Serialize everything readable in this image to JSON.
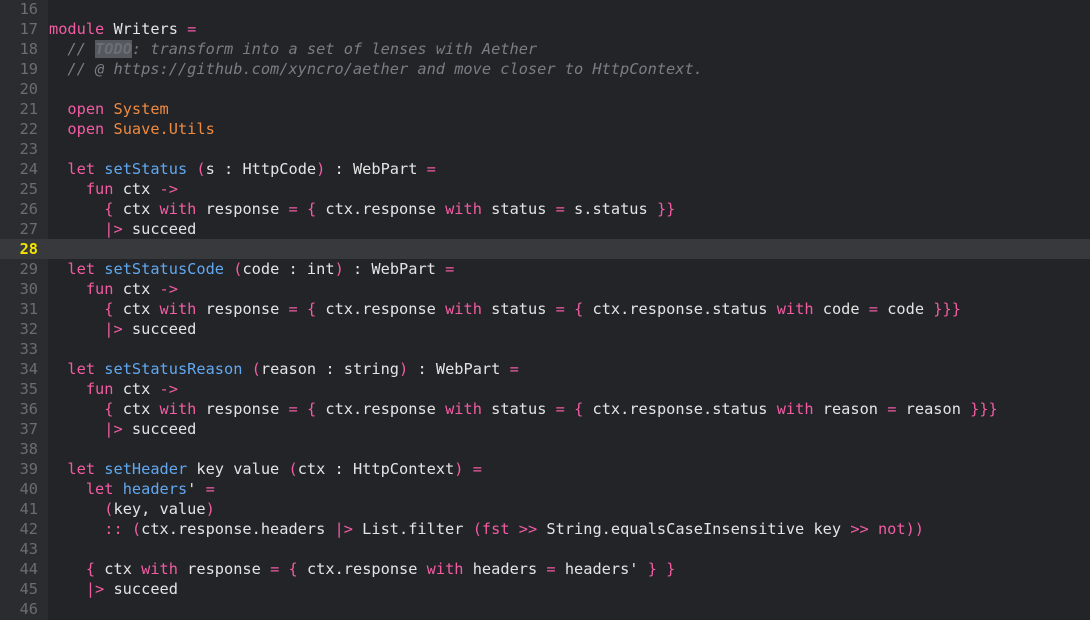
{
  "editor": {
    "current_line": 28,
    "colors": {
      "background": "#222428",
      "gutter": "#2a2c30",
      "current_line": "#37393d",
      "current_line_number": "#f2e300",
      "keyword": "#f25ca3",
      "module": "#f08a3f",
      "function": "#62a8f0",
      "comment": "#7a7d84",
      "text": "#e4e4e4"
    },
    "lines": [
      {
        "n": "16",
        "tokens": []
      },
      {
        "n": "17",
        "tokens": [
          {
            "t": "kw",
            "v": "module"
          },
          {
            "t": "plain",
            "v": " Writers "
          },
          {
            "t": "op",
            "v": "="
          }
        ]
      },
      {
        "n": "18",
        "tokens": [
          {
            "t": "plain",
            "v": "  "
          },
          {
            "t": "cm",
            "v": "// "
          },
          {
            "t": "todo",
            "v": "TODO"
          },
          {
            "t": "cm",
            "v": ": transform into a set of lenses with Aether"
          }
        ]
      },
      {
        "n": "19",
        "tokens": [
          {
            "t": "plain",
            "v": "  "
          },
          {
            "t": "cm",
            "v": "// @ https://github.com/xyncro/aether and move closer to HttpContext."
          }
        ]
      },
      {
        "n": "20",
        "tokens": []
      },
      {
        "n": "21",
        "tokens": [
          {
            "t": "plain",
            "v": "  "
          },
          {
            "t": "kw",
            "v": "open"
          },
          {
            "t": "plain",
            "v": " "
          },
          {
            "t": "mod",
            "v": "System"
          }
        ]
      },
      {
        "n": "22",
        "tokens": [
          {
            "t": "plain",
            "v": "  "
          },
          {
            "t": "kw",
            "v": "open"
          },
          {
            "t": "plain",
            "v": " "
          },
          {
            "t": "mod",
            "v": "Suave.Utils"
          }
        ]
      },
      {
        "n": "23",
        "tokens": []
      },
      {
        "n": "24",
        "tokens": [
          {
            "t": "plain",
            "v": "  "
          },
          {
            "t": "kw",
            "v": "let"
          },
          {
            "t": "plain",
            "v": " "
          },
          {
            "t": "fn",
            "v": "setStatus"
          },
          {
            "t": "plain",
            "v": " "
          },
          {
            "t": "op",
            "v": "("
          },
          {
            "t": "plain",
            "v": "s : HttpCode"
          },
          {
            "t": "op",
            "v": ")"
          },
          {
            "t": "plain",
            "v": " : WebPart "
          },
          {
            "t": "op",
            "v": "="
          }
        ]
      },
      {
        "n": "25",
        "tokens": [
          {
            "t": "plain",
            "v": "    "
          },
          {
            "t": "kw",
            "v": "fun"
          },
          {
            "t": "plain",
            "v": " ctx "
          },
          {
            "t": "op",
            "v": "->"
          }
        ]
      },
      {
        "n": "26",
        "tokens": [
          {
            "t": "plain",
            "v": "      "
          },
          {
            "t": "op",
            "v": "{"
          },
          {
            "t": "plain",
            "v": " ctx "
          },
          {
            "t": "kw",
            "v": "with"
          },
          {
            "t": "plain",
            "v": " response "
          },
          {
            "t": "op",
            "v": "="
          },
          {
            "t": "plain",
            "v": " "
          },
          {
            "t": "op",
            "v": "{"
          },
          {
            "t": "plain",
            "v": " ctx.response "
          },
          {
            "t": "kw",
            "v": "with"
          },
          {
            "t": "plain",
            "v": " status "
          },
          {
            "t": "op",
            "v": "="
          },
          {
            "t": "plain",
            "v": " s.status "
          },
          {
            "t": "op",
            "v": "}}"
          }
        ]
      },
      {
        "n": "27",
        "tokens": [
          {
            "t": "plain",
            "v": "      "
          },
          {
            "t": "op",
            "v": "|>"
          },
          {
            "t": "plain",
            "v": " succeed"
          }
        ]
      },
      {
        "n": "28",
        "tokens": []
      },
      {
        "n": "29",
        "tokens": [
          {
            "t": "plain",
            "v": "  "
          },
          {
            "t": "kw",
            "v": "let"
          },
          {
            "t": "plain",
            "v": " "
          },
          {
            "t": "fn",
            "v": "setStatusCode"
          },
          {
            "t": "plain",
            "v": " "
          },
          {
            "t": "op",
            "v": "("
          },
          {
            "t": "plain",
            "v": "code : int"
          },
          {
            "t": "op",
            "v": ")"
          },
          {
            "t": "plain",
            "v": " : WebPart "
          },
          {
            "t": "op",
            "v": "="
          }
        ]
      },
      {
        "n": "30",
        "tokens": [
          {
            "t": "plain",
            "v": "    "
          },
          {
            "t": "kw",
            "v": "fun"
          },
          {
            "t": "plain",
            "v": " ctx "
          },
          {
            "t": "op",
            "v": "->"
          }
        ]
      },
      {
        "n": "31",
        "tokens": [
          {
            "t": "plain",
            "v": "      "
          },
          {
            "t": "op",
            "v": "{"
          },
          {
            "t": "plain",
            "v": " ctx "
          },
          {
            "t": "kw",
            "v": "with"
          },
          {
            "t": "plain",
            "v": " response "
          },
          {
            "t": "op",
            "v": "="
          },
          {
            "t": "plain",
            "v": " "
          },
          {
            "t": "op",
            "v": "{"
          },
          {
            "t": "plain",
            "v": " ctx.response "
          },
          {
            "t": "kw",
            "v": "with"
          },
          {
            "t": "plain",
            "v": " status "
          },
          {
            "t": "op",
            "v": "="
          },
          {
            "t": "plain",
            "v": " "
          },
          {
            "t": "op",
            "v": "{"
          },
          {
            "t": "plain",
            "v": " ctx.response.status "
          },
          {
            "t": "kw",
            "v": "with"
          },
          {
            "t": "plain",
            "v": " code "
          },
          {
            "t": "op",
            "v": "="
          },
          {
            "t": "plain",
            "v": " code "
          },
          {
            "t": "op",
            "v": "}}}"
          }
        ]
      },
      {
        "n": "32",
        "tokens": [
          {
            "t": "plain",
            "v": "      "
          },
          {
            "t": "op",
            "v": "|>"
          },
          {
            "t": "plain",
            "v": " succeed"
          }
        ]
      },
      {
        "n": "33",
        "tokens": []
      },
      {
        "n": "34",
        "tokens": [
          {
            "t": "plain",
            "v": "  "
          },
          {
            "t": "kw",
            "v": "let"
          },
          {
            "t": "plain",
            "v": " "
          },
          {
            "t": "fn",
            "v": "setStatusReason"
          },
          {
            "t": "plain",
            "v": " "
          },
          {
            "t": "op",
            "v": "("
          },
          {
            "t": "plain",
            "v": "reason : string"
          },
          {
            "t": "op",
            "v": ")"
          },
          {
            "t": "plain",
            "v": " : WebPart "
          },
          {
            "t": "op",
            "v": "="
          }
        ]
      },
      {
        "n": "35",
        "tokens": [
          {
            "t": "plain",
            "v": "    "
          },
          {
            "t": "kw",
            "v": "fun"
          },
          {
            "t": "plain",
            "v": " ctx "
          },
          {
            "t": "op",
            "v": "->"
          }
        ]
      },
      {
        "n": "36",
        "tokens": [
          {
            "t": "plain",
            "v": "      "
          },
          {
            "t": "op",
            "v": "{"
          },
          {
            "t": "plain",
            "v": " ctx "
          },
          {
            "t": "kw",
            "v": "with"
          },
          {
            "t": "plain",
            "v": " response "
          },
          {
            "t": "op",
            "v": "="
          },
          {
            "t": "plain",
            "v": " "
          },
          {
            "t": "op",
            "v": "{"
          },
          {
            "t": "plain",
            "v": " ctx.response "
          },
          {
            "t": "kw",
            "v": "with"
          },
          {
            "t": "plain",
            "v": " status "
          },
          {
            "t": "op",
            "v": "="
          },
          {
            "t": "plain",
            "v": " "
          },
          {
            "t": "op",
            "v": "{"
          },
          {
            "t": "plain",
            "v": " ctx.response.status "
          },
          {
            "t": "kw",
            "v": "with"
          },
          {
            "t": "plain",
            "v": " reason "
          },
          {
            "t": "op",
            "v": "="
          },
          {
            "t": "plain",
            "v": " reason "
          },
          {
            "t": "op",
            "v": "}}}"
          }
        ]
      },
      {
        "n": "37",
        "tokens": [
          {
            "t": "plain",
            "v": "      "
          },
          {
            "t": "op",
            "v": "|>"
          },
          {
            "t": "plain",
            "v": " succeed"
          }
        ]
      },
      {
        "n": "38",
        "tokens": []
      },
      {
        "n": "39",
        "tokens": [
          {
            "t": "plain",
            "v": "  "
          },
          {
            "t": "kw",
            "v": "let"
          },
          {
            "t": "plain",
            "v": " "
          },
          {
            "t": "fn",
            "v": "setHeader"
          },
          {
            "t": "plain",
            "v": " key value "
          },
          {
            "t": "op",
            "v": "("
          },
          {
            "t": "plain",
            "v": "ctx : HttpContext"
          },
          {
            "t": "op",
            "v": ")"
          },
          {
            "t": "plain",
            "v": " "
          },
          {
            "t": "op",
            "v": "="
          }
        ]
      },
      {
        "n": "40",
        "tokens": [
          {
            "t": "plain",
            "v": "    "
          },
          {
            "t": "kw",
            "v": "let"
          },
          {
            "t": "plain",
            "v": " "
          },
          {
            "t": "fn",
            "v": "headers"
          },
          {
            "t": "plain",
            "v": "' "
          },
          {
            "t": "op",
            "v": "="
          }
        ]
      },
      {
        "n": "41",
        "tokens": [
          {
            "t": "plain",
            "v": "      "
          },
          {
            "t": "op",
            "v": "("
          },
          {
            "t": "plain",
            "v": "key, value"
          },
          {
            "t": "op",
            "v": ")"
          }
        ]
      },
      {
        "n": "42",
        "tokens": [
          {
            "t": "plain",
            "v": "      "
          },
          {
            "t": "op",
            "v": "::"
          },
          {
            "t": "plain",
            "v": " "
          },
          {
            "t": "op",
            "v": "("
          },
          {
            "t": "plain",
            "v": "ctx.response.headers "
          },
          {
            "t": "op",
            "v": "|>"
          },
          {
            "t": "plain",
            "v": " List.filter "
          },
          {
            "t": "op",
            "v": "("
          },
          {
            "t": "kw",
            "v": "fst"
          },
          {
            "t": "plain",
            "v": " "
          },
          {
            "t": "op",
            "v": ">>"
          },
          {
            "t": "plain",
            "v": " String.equalsCaseInsensitive key "
          },
          {
            "t": "op",
            "v": ">>"
          },
          {
            "t": "plain",
            "v": " "
          },
          {
            "t": "kw",
            "v": "not"
          },
          {
            "t": "op",
            "v": "))"
          }
        ]
      },
      {
        "n": "43",
        "tokens": []
      },
      {
        "n": "44",
        "tokens": [
          {
            "t": "plain",
            "v": "    "
          },
          {
            "t": "op",
            "v": "{"
          },
          {
            "t": "plain",
            "v": " ctx "
          },
          {
            "t": "kw",
            "v": "with"
          },
          {
            "t": "plain",
            "v": " response "
          },
          {
            "t": "op",
            "v": "="
          },
          {
            "t": "plain",
            "v": " "
          },
          {
            "t": "op",
            "v": "{"
          },
          {
            "t": "plain",
            "v": " ctx.response "
          },
          {
            "t": "kw",
            "v": "with"
          },
          {
            "t": "plain",
            "v": " headers "
          },
          {
            "t": "op",
            "v": "="
          },
          {
            "t": "plain",
            "v": " headers' "
          },
          {
            "t": "op",
            "v": "}"
          },
          {
            "t": "plain",
            "v": " "
          },
          {
            "t": "op",
            "v": "}"
          }
        ]
      },
      {
        "n": "45",
        "tokens": [
          {
            "t": "plain",
            "v": "    "
          },
          {
            "t": "op",
            "v": "|>"
          },
          {
            "t": "plain",
            "v": " succeed"
          }
        ]
      },
      {
        "n": "46",
        "tokens": []
      }
    ]
  }
}
